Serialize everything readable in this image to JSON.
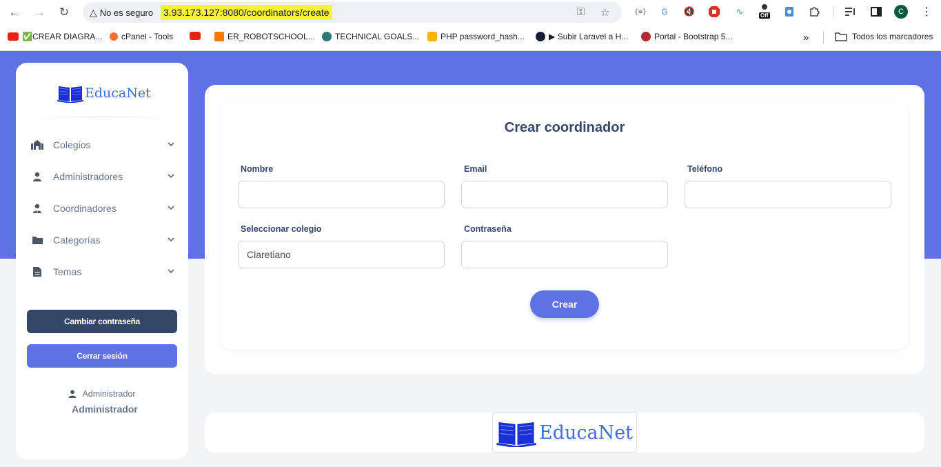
{
  "browser": {
    "security_label": "No es seguro",
    "url": "3.93.173.127:8080/coordinators/create",
    "profile_initial": "C",
    "ext_badge": "Off",
    "bookmarks": [
      {
        "label": "✅CREAR DIAGRA...",
        "color": "#e62117"
      },
      {
        "label": "cPanel - Tools",
        "color": "#ff6c2c"
      },
      {
        "label": "",
        "color": "#e62117"
      },
      {
        "label": "ER_ROBOTSCHOOL...",
        "color": "#f57c00"
      },
      {
        "label": "TECHNICAL GOALS...",
        "color": "#2b7a78"
      },
      {
        "label": "PHP password_hash...",
        "color": "#f4b400"
      },
      {
        "label": "▶ Subir Laravel a H...",
        "color": "#1b1b3a"
      },
      {
        "label": "Portal - Bootstrap 5...",
        "color": "#b02a37"
      }
    ],
    "all_bookmarks": "Todos los marcadores"
  },
  "sidebar": {
    "brand": "EducaNet",
    "items": [
      {
        "label": "Colegios"
      },
      {
        "label": "Administradores"
      },
      {
        "label": "Coordinadores"
      },
      {
        "label": "Categorías"
      },
      {
        "label": "Temas"
      }
    ],
    "change_password": "Cambiar contraseña",
    "logout": "Cerrar sesión",
    "user_role": "Administrador",
    "user_name": "Administrador"
  },
  "form": {
    "title": "Crear coordinador",
    "name_label": "Nombre",
    "name_value": "",
    "email_label": "Email",
    "email_value": "",
    "phone_label": "Teléfono",
    "phone_value": "",
    "school_label": "Seleccionar colegio",
    "school_value": "Claretiano",
    "password_label": "Contraseña",
    "password_value": "",
    "submit": "Crear"
  },
  "footer": {
    "brand": "EducaNet"
  },
  "colors": {
    "primary": "#5e72e4",
    "dark": "#344767",
    "brand_blue": "#3b6ee0"
  }
}
